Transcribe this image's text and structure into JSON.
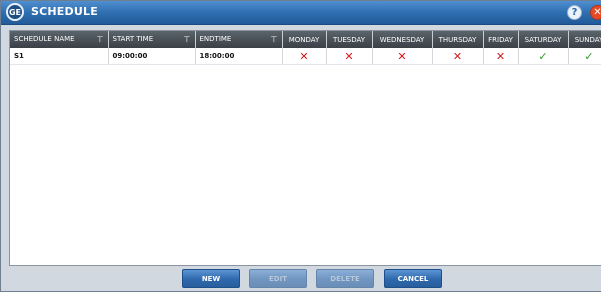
{
  "window": {
    "title": "SCHEDULE",
    "logo_text": "GE",
    "help_glyph": "?",
    "close_glyph": "✕"
  },
  "table": {
    "columns": [
      {
        "label": "SCHEDULE NAME",
        "filter": true
      },
      {
        "label": "START TIME",
        "filter": true
      },
      {
        "label": "ENDTIME",
        "filter": true
      },
      {
        "label": "MONDAY",
        "filter": false
      },
      {
        "label": "TUESDAY",
        "filter": false
      },
      {
        "label": "WEDNESDAY",
        "filter": false
      },
      {
        "label": "THURSDAY",
        "filter": false
      },
      {
        "label": "FRIDAY",
        "filter": false
      },
      {
        "label": "SATURDAY",
        "filter": false
      },
      {
        "label": "SUNDAY",
        "filter": false
      }
    ],
    "filter_icon": "filter-icon",
    "rows": [
      {
        "name": "S1",
        "start_time": "09:00:00",
        "end_time": "18:00:00",
        "days": {
          "monday": "✕",
          "tuesday": "✕",
          "wednesday": "✕",
          "thursday": "✕",
          "friday": "✕",
          "saturday": "✓",
          "sunday": "✓"
        }
      }
    ]
  },
  "footer": {
    "new_label": "NEW",
    "edit_label": "EDIT",
    "delete_label": "DELETE",
    "cancel_label": "CANCEL"
  },
  "colors": {
    "title_bar": "#2f6fb1",
    "header_bg": "#3a4046",
    "cross": "#d51b1b",
    "check": "#2f9c24",
    "button": "#2e69ad"
  }
}
